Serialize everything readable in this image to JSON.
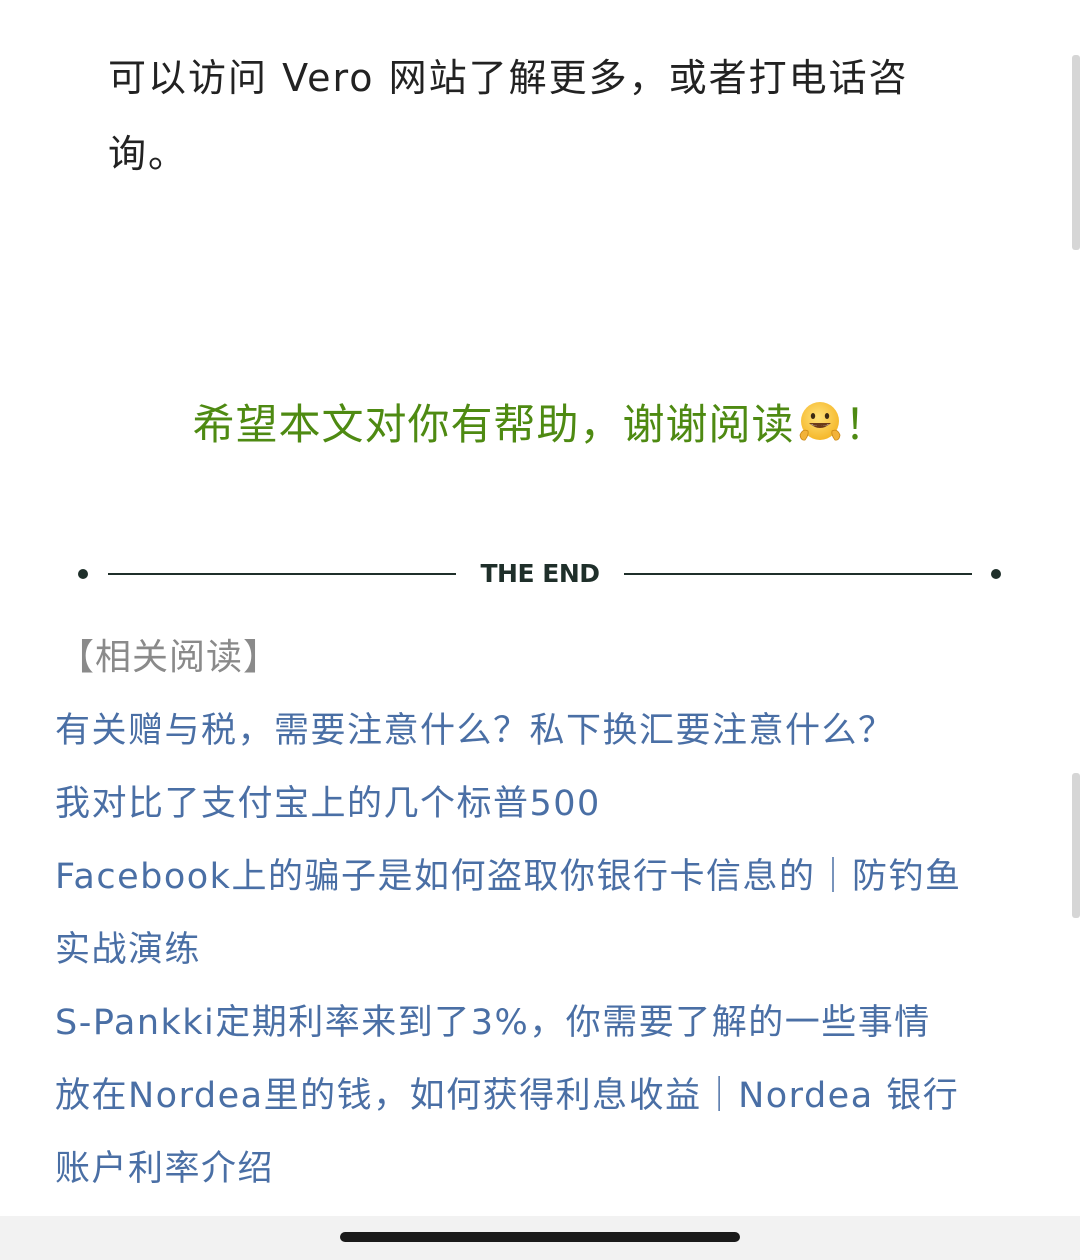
{
  "article": {
    "paragraph_line1": "可以访问 Vero 网站了解更多，或者打电话咨",
    "paragraph_line2": "询。",
    "closing_text": "希望本文对你有帮助，谢谢阅读",
    "closing_emoji": "grinning-face-peace-hands-emoji",
    "closing_punct": "！"
  },
  "divider": {
    "label": "THE END"
  },
  "related": {
    "header": "【相关阅读】",
    "items": [
      {
        "line1": "有关赠与税，需要注意什么？私下换汇要注意什么？",
        "line2": ""
      },
      {
        "line1": "我对比了支付宝上的几个标普500",
        "line2": ""
      },
      {
        "line1": "Facebook上的骗子是如何盗取你银行卡信息的｜防钓鱼",
        "line2": "实战演练"
      },
      {
        "line1": "S-Pankki定期利率来到了3%，你需要了解的一些事情",
        "line2": ""
      },
      {
        "line1": "放在Nordea里的钱，如何获得利息收益｜Nordea 银行",
        "line2": "账户利率介绍"
      }
    ]
  },
  "colors": {
    "closing_green": "#4e8a12",
    "link_blue": "#4a6fa5",
    "header_gray": "#8a8a8a",
    "divider_dark": "#1f2f2a"
  }
}
